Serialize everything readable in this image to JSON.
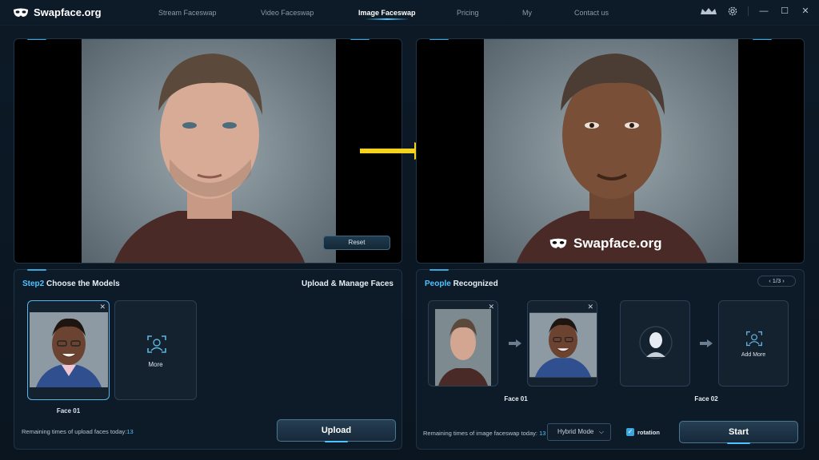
{
  "app": {
    "title": "Swapface.org"
  },
  "nav": {
    "items": [
      {
        "label": "Stream Faceswap"
      },
      {
        "label": "Video Faceswap"
      },
      {
        "label": "Image Faceswap",
        "active": true
      },
      {
        "label": "Pricing"
      },
      {
        "label": "My"
      },
      {
        "label": "Contact us"
      }
    ]
  },
  "viewer": {
    "reset_label": "Reset",
    "watermark": "Swapface.org"
  },
  "models": {
    "step_label": "Step2",
    "title": "Choose the Models",
    "manage_title": "Upload & Manage Faces",
    "cards": [
      {
        "label": "Face 01",
        "selected": true
      },
      {
        "label": "More"
      }
    ],
    "remaining_text": "Remaining times of upload faces today:",
    "remaining_count": "13",
    "upload_label": "Upload"
  },
  "people": {
    "title_highlight": "People",
    "title": "Recognized",
    "pager": "1/3",
    "faces": [
      {
        "label": "Face 01"
      },
      {
        "label": "Face 02",
        "add_label": "Add More"
      }
    ],
    "remaining_text": "Remaining times of image faceswap today:",
    "remaining_count": "13",
    "mode": "Hybrid Mode",
    "rotation_label": "rotation",
    "rotation_checked": true,
    "start_label": "Start"
  },
  "colors": {
    "accent": "#4fc3ff",
    "arrow": "#f5d21b",
    "background": "#0b1622"
  }
}
